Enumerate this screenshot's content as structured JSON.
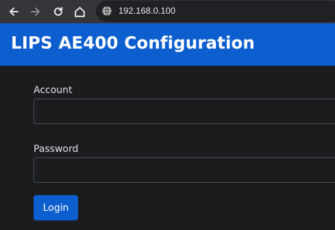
{
  "browser": {
    "url": "192.168.0.100",
    "icons": {
      "back": "arrow-left-icon",
      "forward": "arrow-right-icon",
      "reload": "reload-icon",
      "home": "home-icon",
      "site_info": "globe-icon"
    },
    "colors": {
      "toolbar": "#35363a",
      "address_bar": "#202124",
      "icon_active": "#e8eaed",
      "icon_disabled": "#8a8b8e"
    }
  },
  "header": {
    "title": "LIPS AE400 Configuration",
    "background": "#0d5fcf"
  },
  "form": {
    "account_label": "Account",
    "account_value": "",
    "password_label": "Password",
    "password_value": "",
    "login_label": "Login",
    "accent": "#0d5fcf",
    "page_background": "#1b1c1e"
  }
}
